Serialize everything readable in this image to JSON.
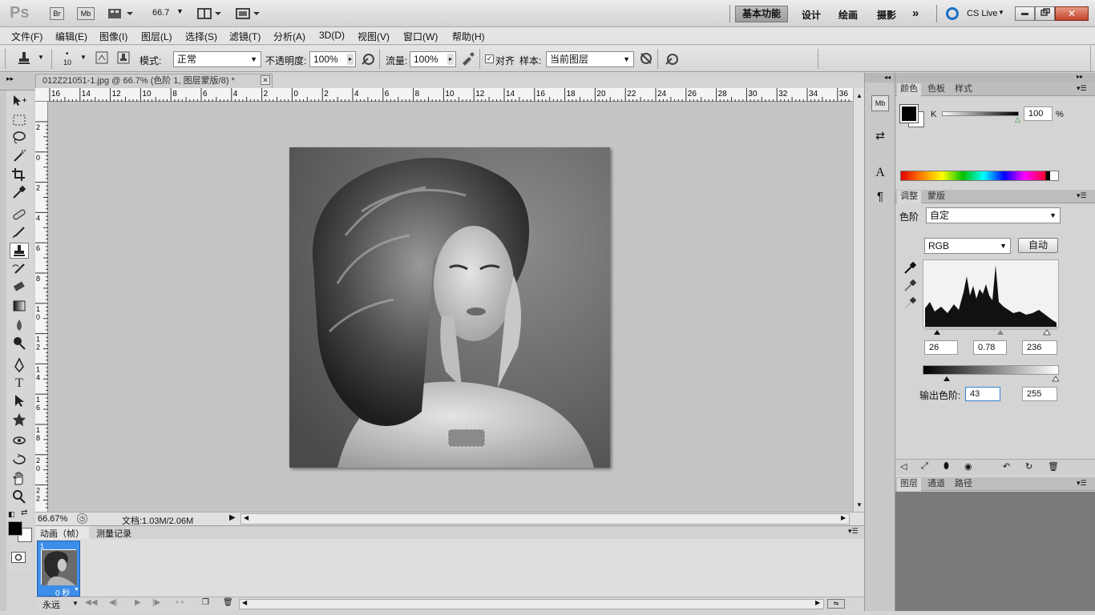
{
  "appbar": {
    "logo": "Ps",
    "br": "Br",
    "mb": "Mb",
    "zoom": "66.7",
    "workspaces": [
      "基本功能",
      "设计",
      "绘画",
      "摄影"
    ],
    "more": "»",
    "cslive": "CS Live"
  },
  "menu": [
    "文件(F)",
    "编辑(E)",
    "图像(I)",
    "图层(L)",
    "选择(S)",
    "滤镜(T)",
    "分析(A)",
    "3D(D)",
    "视图(V)",
    "窗口(W)",
    "帮助(H)"
  ],
  "options": {
    "brush_size": "10",
    "mode_label": "模式:",
    "mode_value": "正常",
    "opacity_label": "不透明度:",
    "opacity_value": "100%",
    "flow_label": "流量:",
    "flow_value": "100%",
    "align_label": "对齐",
    "sample_label": "样本:",
    "sample_value": "当前图层"
  },
  "document": {
    "tab_title": "012Z21051-1.jpg @ 66.7% (色阶 1, 图层蒙版/8) *",
    "ruler_top": [
      "16",
      "14",
      "12",
      "10",
      "8",
      "6",
      "4",
      "2",
      "0",
      "2",
      "4",
      "6",
      "8",
      "10",
      "12",
      "14",
      "16",
      "18",
      "20",
      "22",
      "24",
      "26",
      "28",
      "30",
      "32",
      "34",
      "36"
    ],
    "ruler_left": [
      "2",
      "0",
      "2",
      "4",
      "6",
      "8",
      "1 0",
      "1 2",
      "1 4",
      "1 6",
      "1 8",
      "2 0",
      "2 2"
    ]
  },
  "status": {
    "zoom": "66.67%",
    "doc": "文档:1.03M/2.06M"
  },
  "animation": {
    "tabs": [
      "动画（帧）",
      "测量记录"
    ],
    "frame_num": "1",
    "frame_time": "0 秒",
    "loop": "永远"
  },
  "color_panel": {
    "tabs": [
      "颜色",
      "色板",
      "样式"
    ],
    "channel": "K",
    "value": "100",
    "unit": "%"
  },
  "adjust_panel": {
    "tabs": [
      "调整",
      "蒙版"
    ],
    "preset_label": "色阶",
    "preset_value": "自定",
    "channel": "RGB",
    "auto_button": "自动",
    "input_black": "26",
    "input_mid": "0.78",
    "input_white": "236",
    "output_label": "输出色阶:",
    "output_black": "43",
    "output_white": "255"
  },
  "layers_panel": {
    "tabs": [
      "图层",
      "通道",
      "路径"
    ]
  }
}
